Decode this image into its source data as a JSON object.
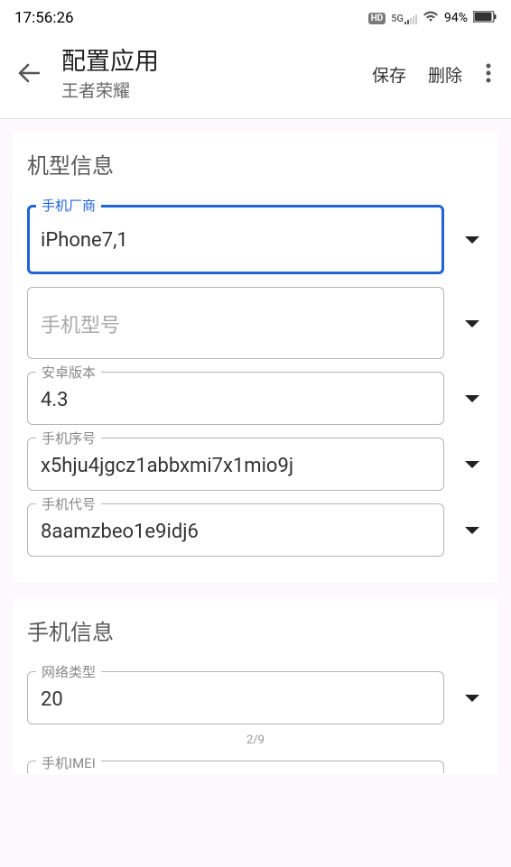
{
  "status": {
    "time": "17:56:26",
    "hd": "HD",
    "network": "5G",
    "battery_pct": "94%"
  },
  "header": {
    "title": "配置应用",
    "subtitle": "王者荣耀",
    "save": "保存",
    "delete": "删除"
  },
  "section1": {
    "title": "机型信息",
    "fields": {
      "vendor": {
        "label": "手机厂商",
        "value": "iPhone7,1"
      },
      "model": {
        "label": "",
        "placeholder": "手机型号"
      },
      "android": {
        "label": "安卓版本",
        "value": "4.3"
      },
      "serial": {
        "label": "手机序号",
        "value": "x5hju4jgcz1abbxmi7x1mio9j"
      },
      "codename": {
        "label": "手机代号",
        "value": "8aamzbeo1e9idj6"
      }
    }
  },
  "section2": {
    "title": "手机信息",
    "fields": {
      "nettype": {
        "label": "网络类型",
        "value": "20"
      },
      "imei": {
        "label": "手机IMEI"
      }
    }
  },
  "page_indicator": "2/9"
}
